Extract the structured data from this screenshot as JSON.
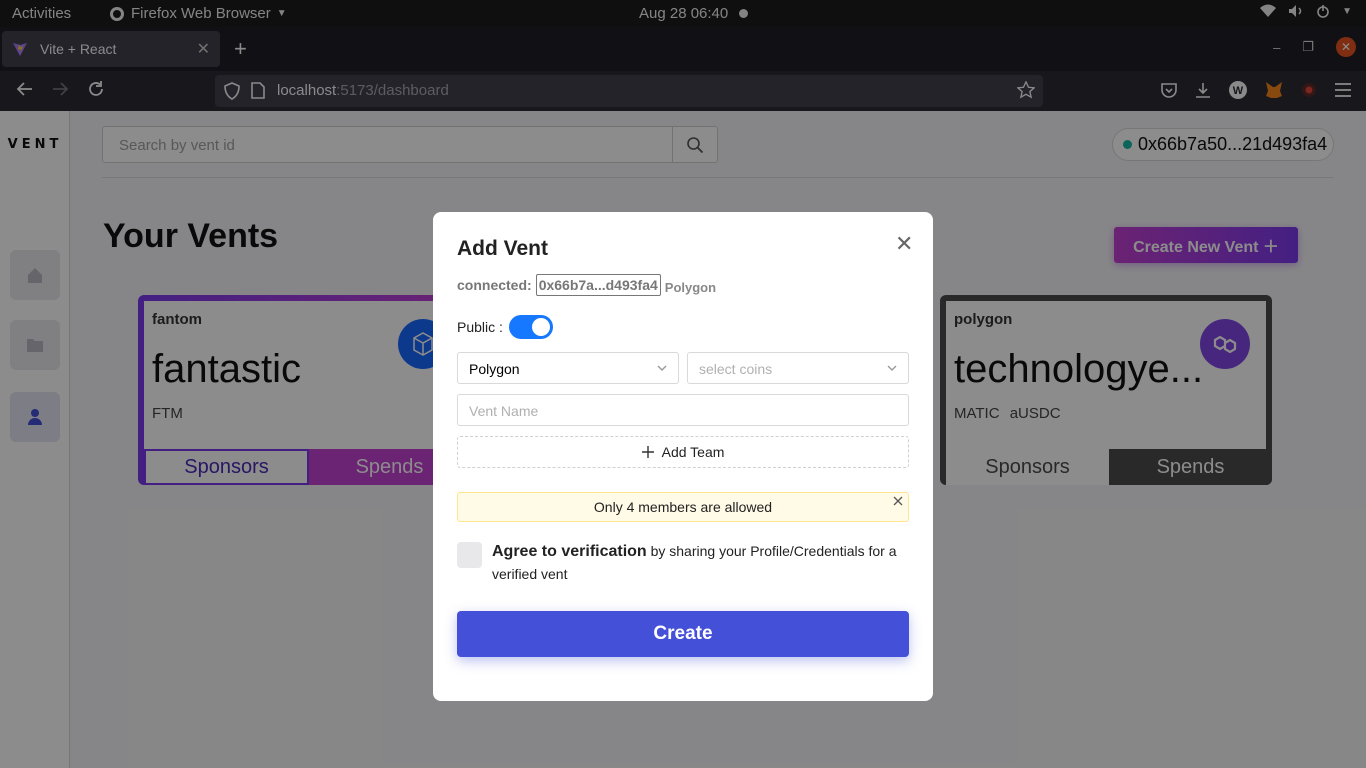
{
  "system": {
    "activities": "Activities",
    "app_name": "Firefox Web Browser",
    "clock": "Aug 28  06:40"
  },
  "browser": {
    "tab_title": "Vite + React",
    "url_host": "localhost",
    "url_rest": ":5173/dashboard"
  },
  "app": {
    "logo": "VENT",
    "search_placeholder": "Search by vent id",
    "wallet_address": "0x66b7a50...21d493fa4",
    "heading": "Your Vents",
    "create_button": "Create New Vent ＋",
    "colors": {
      "accent": "#4450d8",
      "gradient_start": "#c440d2",
      "gradient_end": "#7c3aed"
    },
    "vents": [
      {
        "network": "fantom",
        "name": "fantastic",
        "coins": "FTM",
        "sponsors": "Sponsors",
        "spends": "Spends",
        "icon": "fantom-logo-icon"
      },
      {
        "network": "polygon",
        "name": "technologye...",
        "coins": "MATIC  aUSDC",
        "sponsors": "Sponsors",
        "spends": "Spends",
        "icon": "polygon-logo-icon"
      }
    ]
  },
  "modal": {
    "title": "Add Vent",
    "connected_label": "connected:",
    "connected_address": "0x66b7a...d493fa4",
    "connected_chain": "Polygon",
    "public_label": "Public :",
    "public_on": true,
    "chain_select": "Polygon",
    "coins_placeholder": "select coins",
    "vent_name_placeholder": "Vent Name",
    "add_team": "Add Team",
    "alert": "Only 4 members are allowed",
    "agree_bold": "Agree to verification",
    "agree_rest": " by sharing your Profile/Credentials for a verified vent",
    "create": "Create"
  }
}
